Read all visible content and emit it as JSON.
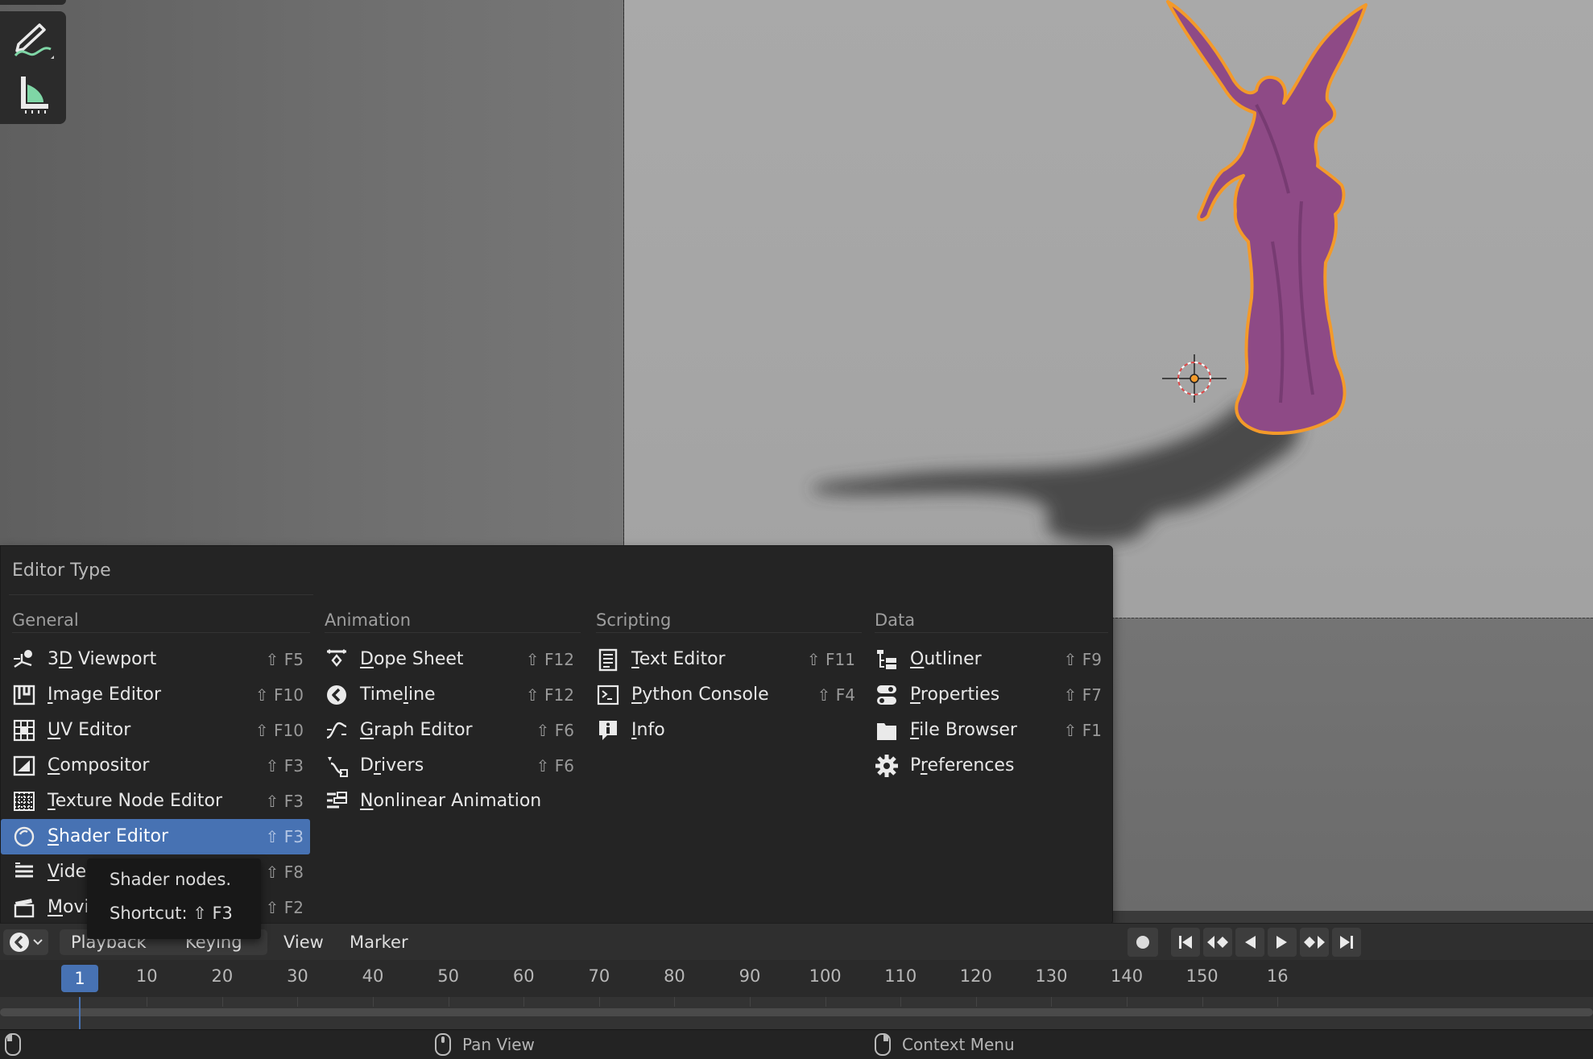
{
  "menu": {
    "title": "Editor Type",
    "columns": {
      "general": {
        "header": "General",
        "items": [
          {
            "pre": "3",
            "ul": "D",
            "post": " Viewport",
            "shortcut": "⇧ F5",
            "icon": "3d-viewport-icon"
          },
          {
            "pre": "",
            "ul": "I",
            "post": "mage Editor",
            "shortcut": "⇧ F10",
            "icon": "image-editor-icon"
          },
          {
            "pre": "",
            "ul": "U",
            "post": "V Editor",
            "shortcut": "⇧ F10",
            "icon": "uv-editor-icon"
          },
          {
            "pre": "",
            "ul": "C",
            "post": "ompositor",
            "shortcut": "⇧ F3",
            "icon": "compositor-icon"
          },
          {
            "pre": "",
            "ul": "T",
            "post": "exture Node Editor",
            "shortcut": "⇧ F3",
            "icon": "texture-node-editor-icon"
          },
          {
            "pre": "",
            "ul": "S",
            "post": "hader Editor",
            "shortcut": "⇧ F3",
            "icon": "shader-editor-icon"
          },
          {
            "pre": "",
            "ul": "V",
            "post": "ideo Sequencer",
            "shortcut": "⇧ F8",
            "icon": "video-sequencer-icon"
          },
          {
            "pre": "",
            "ul": "M",
            "post": "ovie Clip Editor",
            "shortcut": "⇧ F2",
            "icon": "movie-clip-editor-icon"
          }
        ]
      },
      "animation": {
        "header": "Animation",
        "items": [
          {
            "pre": "",
            "ul": "D",
            "post": "ope Sheet",
            "shortcut": "⇧ F12",
            "icon": "dope-sheet-icon"
          },
          {
            "pre": "Time",
            "ul": "l",
            "post": "ine",
            "shortcut": "⇧ F12",
            "icon": "timeline-icon"
          },
          {
            "pre": "",
            "ul": "G",
            "post": "raph Editor",
            "shortcut": "⇧ F6",
            "icon": "graph-editor-icon"
          },
          {
            "pre": "D",
            "ul": "r",
            "post": "ivers",
            "shortcut": "⇧ F6",
            "icon": "drivers-icon"
          },
          {
            "pre": "",
            "ul": "N",
            "post": "onlinear Animation",
            "shortcut": "",
            "icon": "nonlinear-animation-icon"
          }
        ]
      },
      "scripting": {
        "header": "Scripting",
        "items": [
          {
            "pre": "",
            "ul": "T",
            "post": "ext Editor",
            "shortcut": "⇧ F11",
            "icon": "text-editor-icon"
          },
          {
            "pre": "",
            "ul": "P",
            "post": "ython Console",
            "shortcut": "⇧ F4",
            "icon": "python-console-icon"
          },
          {
            "pre": "",
            "ul": "I",
            "post": "nfo",
            "shortcut": "",
            "icon": "info-icon"
          }
        ]
      },
      "data": {
        "header": "Data",
        "items": [
          {
            "pre": "",
            "ul": "O",
            "post": "utliner",
            "shortcut": "⇧ F9",
            "icon": "outliner-icon"
          },
          {
            "pre": "",
            "ul": "P",
            "post": "roperties",
            "shortcut": "⇧ F7",
            "icon": "properties-icon"
          },
          {
            "pre": "",
            "ul": "F",
            "post": "ile Browser",
            "shortcut": "⇧ F1",
            "icon": "file-browser-icon"
          },
          {
            "pre": "P",
            "ul": "r",
            "post": "eferences",
            "shortcut": "",
            "icon": "preferences-icon"
          }
        ]
      }
    },
    "active_item": "Shader Editor"
  },
  "tooltip": {
    "description": "Shader nodes.",
    "shortcut": "Shortcut: ⇧ F3"
  },
  "timeline": {
    "menus": [
      "Playback",
      "Keying",
      "View",
      "Marker"
    ],
    "current_frame": "1",
    "ticks": [
      "10",
      "20",
      "30",
      "40",
      "50",
      "60",
      "70",
      "80",
      "90",
      "100",
      "110",
      "120",
      "130",
      "140",
      "150",
      "16"
    ]
  },
  "statusbar": {
    "pan_view": "Pan View",
    "context_menu": "Context Menu"
  },
  "colors": {
    "accent": "#4772b3",
    "selection_outline": "#f39a2a",
    "statue": "#8e4a86"
  }
}
